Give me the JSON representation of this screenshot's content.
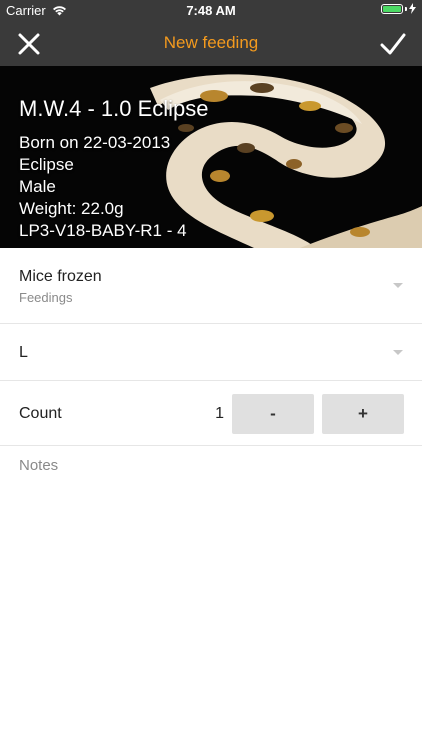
{
  "status_bar": {
    "carrier": "Carrier",
    "time": "7:48 AM",
    "icons": [
      "wifi-icon",
      "battery-icon",
      "charging-icon"
    ],
    "battery_color": "#4cd964"
  },
  "nav": {
    "title": "New feeding",
    "left_icon": "close-icon",
    "right_icon": "checkmark-icon",
    "title_color": "#f39a1e",
    "bar_color": "#3a3a3a"
  },
  "animal": {
    "name": "M.W.4 - 1.0 Eclipse",
    "born": "Born on 22-03-2013",
    "morph": "Eclipse",
    "sex": "Male",
    "weight": "Weight: 22.0g",
    "location": "LP3-V18-BABY-R1 - 4",
    "image": "ball-python-photo"
  },
  "form": {
    "food": {
      "value": "Mice frozen",
      "category": "Feedings",
      "icon": "dropdown-arrow-icon"
    },
    "size": {
      "value": "L",
      "icon": "dropdown-arrow-icon"
    },
    "count": {
      "label": "Count",
      "value": "1",
      "minus_label": "-",
      "plus_label": "+"
    },
    "notes": {
      "placeholder": "Notes"
    }
  }
}
